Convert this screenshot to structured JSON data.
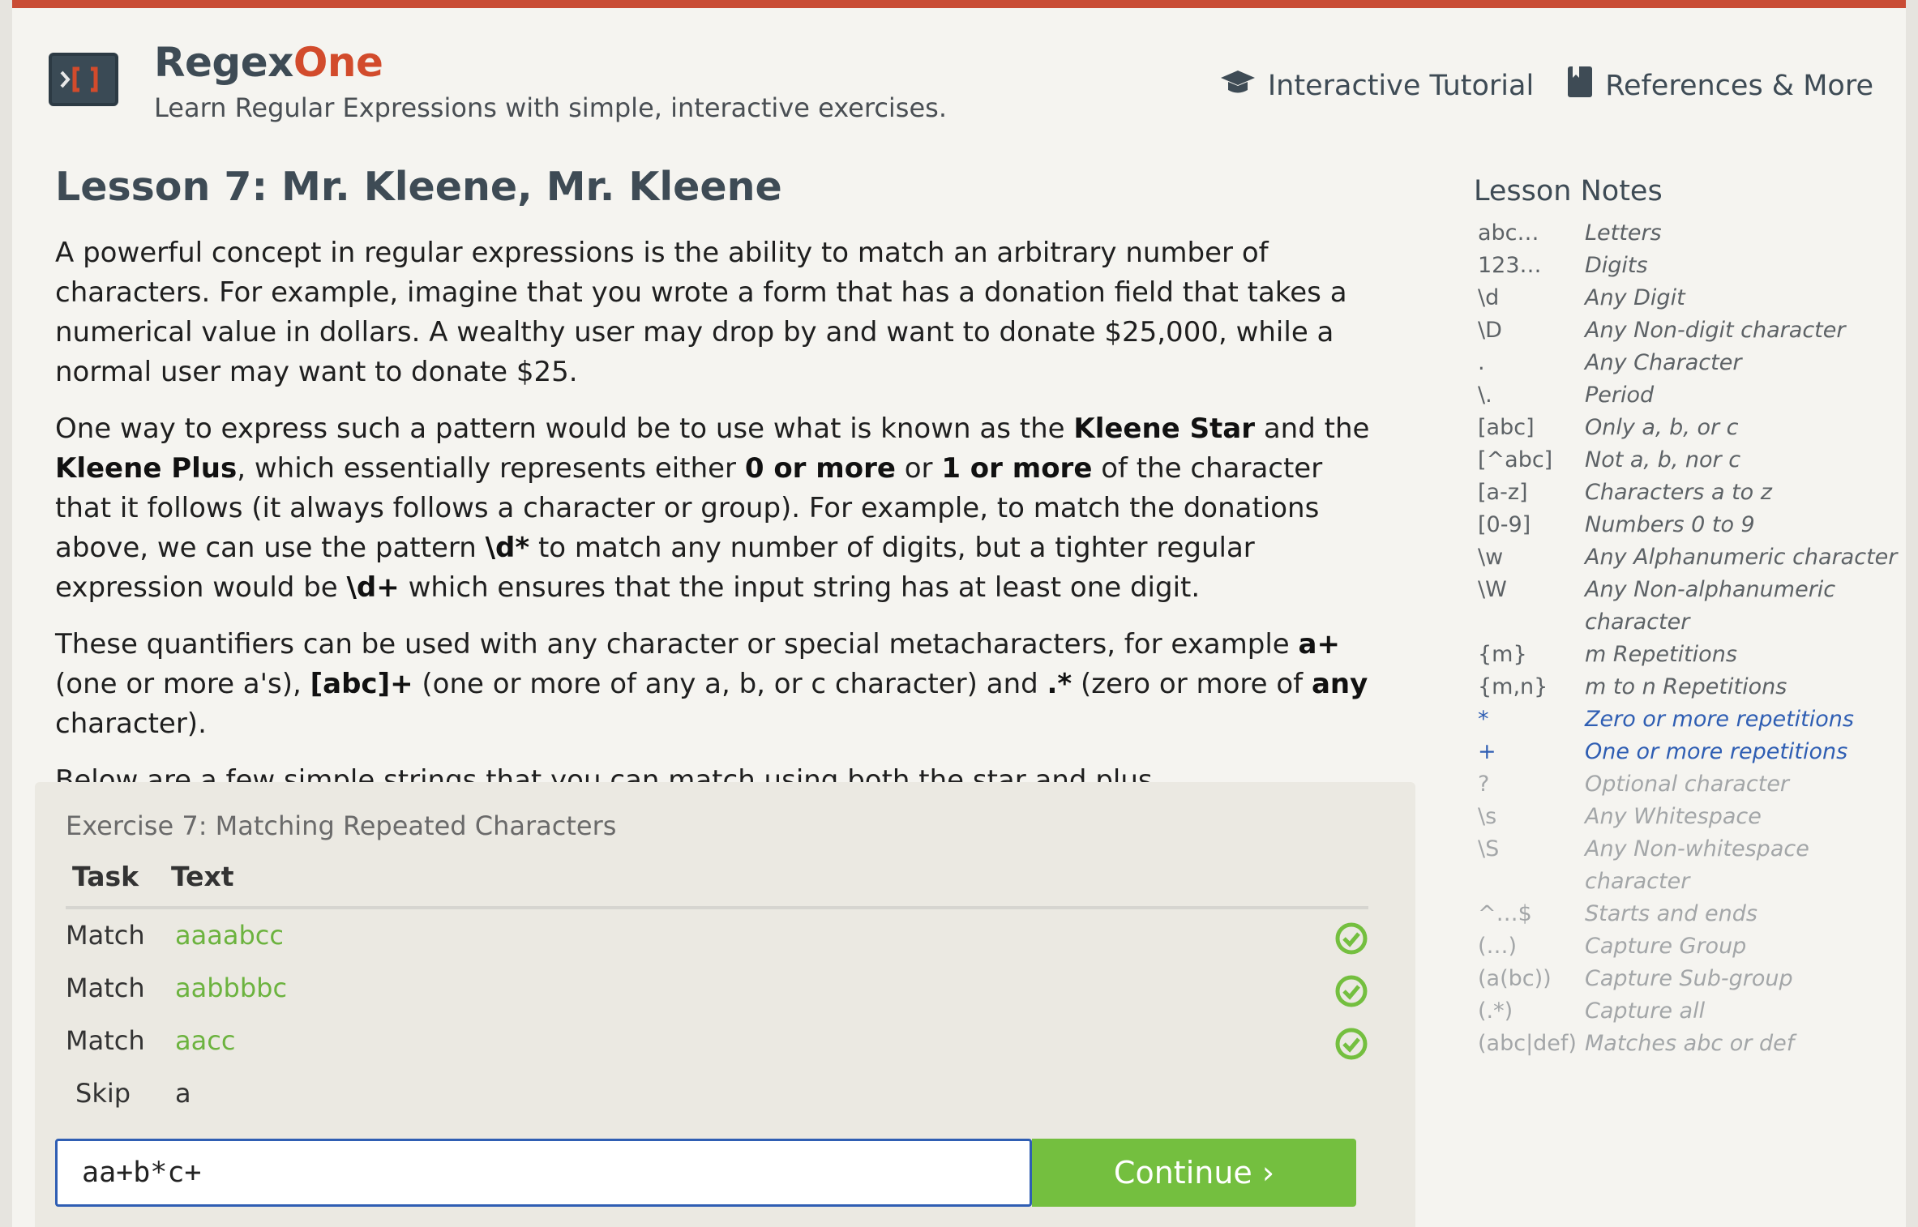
{
  "header": {
    "brand_main": "Regex",
    "brand_accent": "One",
    "tagline": "Learn Regular Expressions with simple, interactive exercises.",
    "nav": [
      {
        "label": "Interactive Tutorial",
        "icon": "graduation-cap-icon"
      },
      {
        "label": "References & More",
        "icon": "book-icon"
      }
    ]
  },
  "lesson": {
    "title": "Lesson 7: Mr. Kleene, Mr. Kleene",
    "p1": "A powerful concept in regular expressions is the ability to match an arbitrary number of characters. For example, imagine that you wrote a form that has a donation field that takes a numerical value in dollars. A wealthy user may drop by and want to donate $25,000, while a normal user may want to donate $25.",
    "p2": {
      "t1": "One way to express such a pattern would be to use what is known as the ",
      "b1": "Kleene Star",
      "t2": " and the ",
      "b2": "Kleene Plus",
      "t3": ", which essentially represents either ",
      "b3": "0 or more",
      "t4": " or ",
      "b4": "1 or more",
      "t5": " of the character that it follows (it always follows a character or group). For example, to match the donations above, we can use the pattern ",
      "b5": "\\d*",
      "t6": " to match any number of digits, but a tighter regular expression would be ",
      "b6": "\\d+",
      "t7": " which ensures that the input string has at least one digit."
    },
    "p3": {
      "t1": "These quantifiers can be used with any character or special metacharacters, for example ",
      "b1": "a+",
      "t2": " (one or more a's), ",
      "b2": "[abc]+",
      "t3": " (one or more of any a, b, or c character) and ",
      "b3": ".*",
      "t4": " (zero or more of ",
      "b4": "any",
      "t5": " character)."
    },
    "p4": "Below are a few simple strings that you can match using both the star and plus metacharacters."
  },
  "exercise": {
    "title": "Exercise 7: Matching Repeated Characters",
    "col_task": "Task",
    "col_text": "Text",
    "rows": [
      {
        "task": "Match",
        "text": "aaaabcc",
        "status": "matched"
      },
      {
        "task": "Match",
        "text": "aabbbbc",
        "status": "matched"
      },
      {
        "task": "Match",
        "text": "aacc",
        "status": "matched"
      },
      {
        "task": "Skip",
        "text": "a",
        "status": "none"
      }
    ],
    "input_value": "aa+b*c+",
    "continue_label": "Continue ›"
  },
  "notes": {
    "title": "Lesson Notes",
    "items": [
      {
        "key": "abc…",
        "val": "Letters",
        "state": "done"
      },
      {
        "key": "123…",
        "val": "Digits",
        "state": "done"
      },
      {
        "key": "\\d",
        "val": "Any Digit",
        "state": "done"
      },
      {
        "key": "\\D",
        "val": "Any Non-digit character",
        "state": "done"
      },
      {
        "key": ".",
        "val": "Any Character",
        "state": "done"
      },
      {
        "key": "\\.",
        "val": "Period",
        "state": "done"
      },
      {
        "key": "[abc]",
        "val": "Only a, b, or c",
        "state": "done"
      },
      {
        "key": "[^abc]",
        "val": "Not a, b, nor c",
        "state": "done"
      },
      {
        "key": "[a-z]",
        "val": "Characters a to z",
        "state": "done"
      },
      {
        "key": "[0-9]",
        "val": "Numbers 0 to 9",
        "state": "done"
      },
      {
        "key": "\\w",
        "val": "Any Alphanumeric character",
        "state": "done"
      },
      {
        "key": "\\W",
        "val": "Any Non-alphanumeric character",
        "state": "done"
      },
      {
        "key": "{m}",
        "val": "m Repetitions",
        "state": "done"
      },
      {
        "key": "{m,n}",
        "val": "m to n Repetitions",
        "state": "done"
      },
      {
        "key": "*",
        "val": "Zero or more repetitions",
        "state": "active"
      },
      {
        "key": "+",
        "val": "One or more repetitions",
        "state": "active"
      },
      {
        "key": "?",
        "val": "Optional character",
        "state": "future"
      },
      {
        "key": "\\s",
        "val": "Any Whitespace",
        "state": "future"
      },
      {
        "key": "\\S",
        "val": "Any Non-whitespace character",
        "state": "future"
      },
      {
        "key": "^…$",
        "val": "Starts and ends",
        "state": "future"
      },
      {
        "key": "(…)",
        "val": "Capture Group",
        "state": "future"
      },
      {
        "key": "(a(bc))",
        "val": "Capture Sub-group",
        "state": "future"
      },
      {
        "key": "(.*)",
        "val": "Capture all",
        "state": "future"
      },
      {
        "key": "(abc|def)",
        "val": "Matches abc or def",
        "state": "future"
      }
    ]
  },
  "colors": {
    "accent_red": "#c94c35",
    "brand_orange": "#d24b2c",
    "success_green": "#74bf3f",
    "focus_blue": "#2f5eb3"
  }
}
